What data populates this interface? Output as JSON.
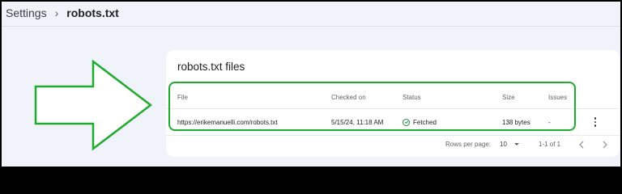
{
  "breadcrumb": {
    "parent": "Settings",
    "separator_icon": "chevron-right-icon",
    "current": "robots.txt"
  },
  "card": {
    "title": "robots.txt files"
  },
  "table": {
    "headers": {
      "file": "File",
      "checked_on": "Checked on",
      "status": "Status",
      "size": "Size",
      "issues": "Issues"
    },
    "rows": [
      {
        "file": "https://erikemanuelli.com/robots.txt",
        "checked_on": "5/15/24, 11:18 AM",
        "status": "Fetched",
        "status_icon": "check-circle-icon",
        "size": "138 bytes",
        "issues": "-",
        "menu_icon": "more-vert-icon"
      }
    ]
  },
  "pagination": {
    "rows_per_page_label": "Rows per page:",
    "rows_per_page_value": "10",
    "range": "1-1 of 1",
    "prev_icon": "chevron-left-icon",
    "next_icon": "chevron-right-icon"
  },
  "annotation": {
    "color": "#1fab2f",
    "arrow_icon": "right-arrow-outline-icon"
  },
  "colors": {
    "page_background": "#f0f3f9",
    "card_background": "#ffffff",
    "status_success": "#1e8e3e"
  }
}
